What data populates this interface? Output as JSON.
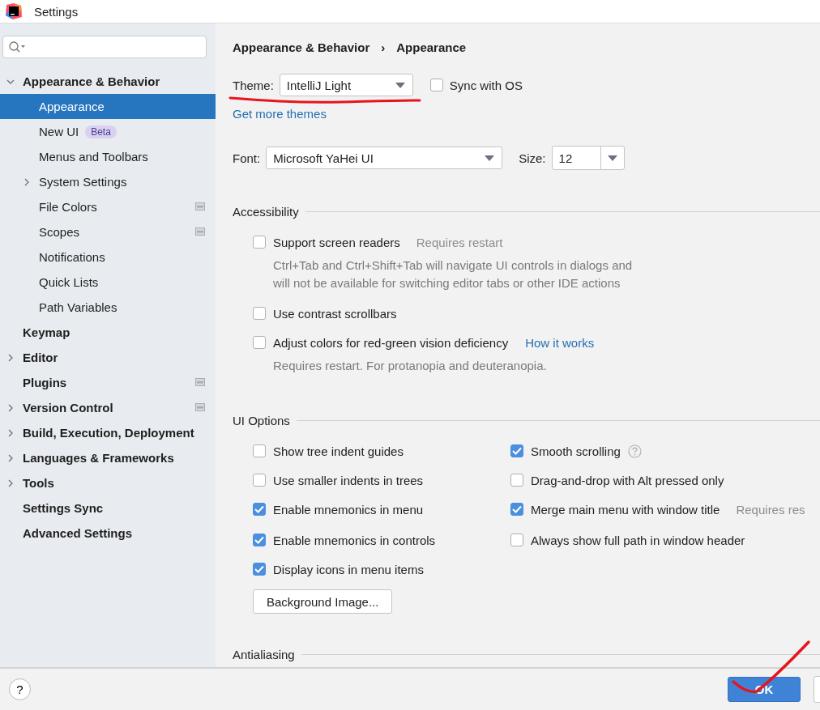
{
  "window": {
    "title": "Settings"
  },
  "sidebar": {
    "items": [
      {
        "label": "Appearance & Behavior",
        "selected": false,
        "expanded": true,
        "scoped": false,
        "children": [
          {
            "label": "Appearance",
            "selected": true,
            "scoped": false
          },
          {
            "label": "New UI",
            "selected": false,
            "scoped": false,
            "badge": "Beta"
          },
          {
            "label": "Menus and Toolbars",
            "selected": false,
            "scoped": false
          },
          {
            "label": "System Settings",
            "selected": false,
            "expanded": false,
            "scoped": false
          },
          {
            "label": "File Colors",
            "selected": false,
            "scoped": true
          },
          {
            "label": "Scopes",
            "selected": false,
            "scoped": true
          },
          {
            "label": "Notifications",
            "selected": false,
            "scoped": false
          },
          {
            "label": "Quick Lists",
            "selected": false,
            "scoped": false
          },
          {
            "label": "Path Variables",
            "selected": false,
            "scoped": false
          }
        ]
      },
      {
        "label": "Keymap",
        "selected": false,
        "scoped": false
      },
      {
        "label": "Editor",
        "selected": false,
        "expanded": false,
        "scoped": false
      },
      {
        "label": "Plugins",
        "selected": false,
        "scoped": true
      },
      {
        "label": "Version Control",
        "selected": false,
        "expanded": false,
        "scoped": true
      },
      {
        "label": "Build, Execution, Deployment",
        "selected": false,
        "expanded": false,
        "scoped": false
      },
      {
        "label": "Languages & Frameworks",
        "selected": false,
        "expanded": false,
        "scoped": false
      },
      {
        "label": "Tools",
        "selected": false,
        "expanded": false,
        "scoped": false
      },
      {
        "label": "Settings Sync",
        "selected": false,
        "scoped": false
      },
      {
        "label": "Advanced Settings",
        "selected": false,
        "scoped": false
      }
    ]
  },
  "breadcrumb": [
    "Appearance & Behavior",
    "›",
    "Appearance"
  ],
  "theme": {
    "label": "Theme:",
    "value": "IntelliJ Light",
    "sync": {
      "label": "Sync with OS",
      "checked": false
    },
    "link": "Get more themes"
  },
  "font": {
    "label": "Font:",
    "value": "Microsoft YaHei UI",
    "size_label": "Size:",
    "size": "12"
  },
  "accessibility": {
    "title": "Accessibility",
    "options": [
      {
        "label": "Support screen readers",
        "checked": false,
        "hint": "Requires restart",
        "description": [
          "Ctrl+Tab and Ctrl+Shift+Tab will navigate UI controls in dialogs and",
          "will not be available for switching editor tabs or other IDE actions"
        ]
      },
      {
        "label": "Use contrast scrollbars",
        "checked": false
      },
      {
        "label": "Adjust colors for red-green vision deficiency",
        "checked": false,
        "link": "How it works",
        "description": [
          "Requires restart. For protanopia and deuteranopia."
        ]
      }
    ]
  },
  "ui_options": {
    "title": "UI Options",
    "left": [
      {
        "label": "Show tree indent guides",
        "checked": false
      },
      {
        "label": "Use smaller indents in trees",
        "checked": false
      },
      {
        "label": "Enable mnemonics in menu",
        "checked": true
      },
      {
        "label": "Enable mnemonics in controls",
        "checked": true
      },
      {
        "label": "Display icons in menu items",
        "checked": true
      }
    ],
    "right": [
      {
        "label": "Smooth scrolling",
        "checked": true,
        "help": true
      },
      {
        "label": "Drag-and-drop with Alt pressed only",
        "checked": false,
        "help": false
      },
      {
        "label": "Merge main menu with window title",
        "checked": true,
        "help": false,
        "hint": "Requires res"
      },
      {
        "label": "Always show full path in window header",
        "checked": false,
        "help": false
      }
    ],
    "button": "Background Image..."
  },
  "antialiasing": {
    "title": "Antialiasing"
  },
  "footer": {
    "help": "?",
    "ok": "OK"
  }
}
